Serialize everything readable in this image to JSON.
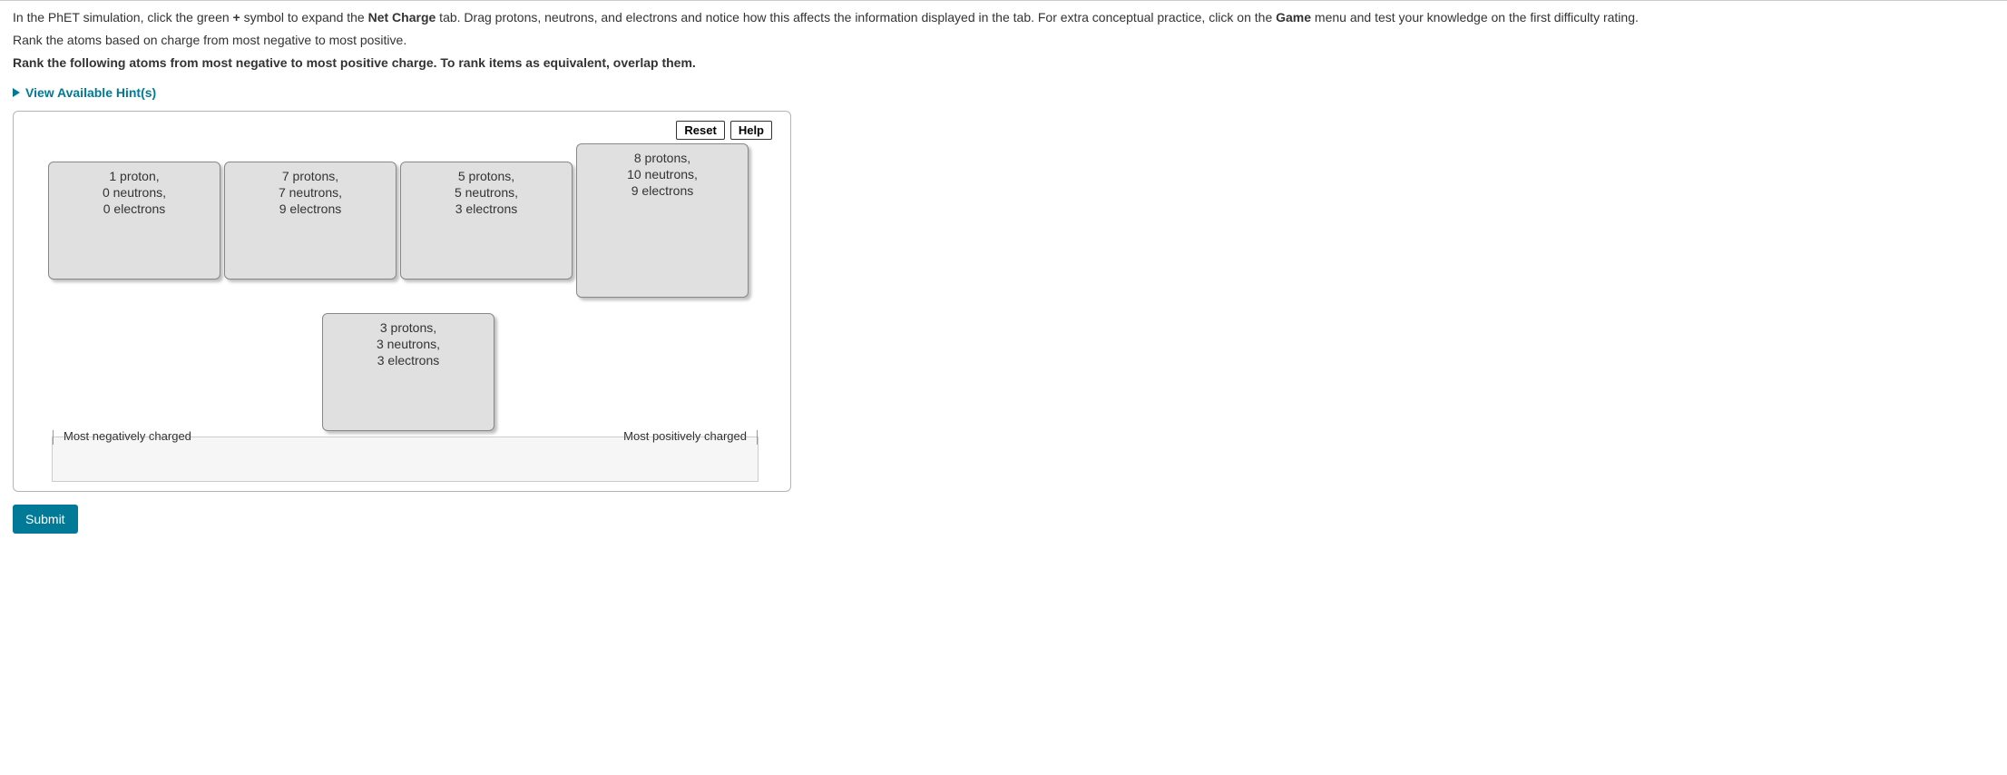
{
  "instructions": {
    "p1_prefix": "In the PhET simulation, click the green ",
    "p1_symbol": "+",
    "p1_mid1": " symbol to expand the ",
    "p1_bold1": "Net Charge",
    "p1_mid2": " tab. Drag protons, neutrons, and electrons and notice how this affects the information displayed in the tab.  For extra conceptual practice, click on the ",
    "p1_bold2": "Game",
    "p1_suffix": " menu and test your knowledge on the first difficulty rating.",
    "p2": "Rank the atoms based on charge from most negative to most positive.",
    "p3": "Rank the following atoms from most negative to most positive charge.  To rank items as equivalent, overlap them."
  },
  "hints_label": "View Available Hint(s)",
  "controls": {
    "reset": "Reset",
    "help": "Help"
  },
  "cards": {
    "c1": {
      "l1": "1 proton,",
      "l2": "0 neutrons,",
      "l3": "0 electrons"
    },
    "c2": {
      "l1": "7 protons,",
      "l2": "7 neutrons,",
      "l3": "9 electrons"
    },
    "c3": {
      "l1": "5 protons,",
      "l2": "5 neutrons,",
      "l3": "3 electrons"
    },
    "c4": {
      "l1": "8 protons,",
      "l2": "10 neutrons,",
      "l3": "9 electrons"
    },
    "c5": {
      "l1": "3 protons,",
      "l2": "3 neutrons,",
      "l3": "3 electrons"
    }
  },
  "dropzone": {
    "left": "Most negatively charged",
    "right": "Most positively charged"
  },
  "submit": "Submit"
}
